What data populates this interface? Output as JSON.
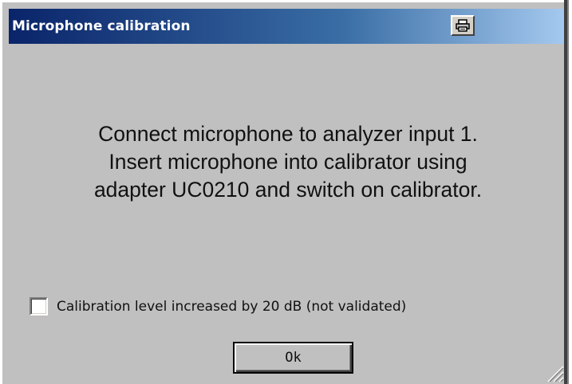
{
  "window": {
    "title": "Microphone calibration",
    "title_button_icon": "printer-icon"
  },
  "message": {
    "line1": "Connect microphone to analyzer input 1.",
    "line2": "Insert microphone into calibrator using",
    "line3": "adapter UC0210 and switch on calibrator."
  },
  "checkbox": {
    "label": "Calibration level increased by 20 dB (not validated)",
    "checked": false
  },
  "buttons": {
    "ok_label": "Ok"
  },
  "colors": {
    "titlebar_start": "#0a246a",
    "titlebar_end": "#a6caf0",
    "dialog_background": "#c0c0c0"
  }
}
